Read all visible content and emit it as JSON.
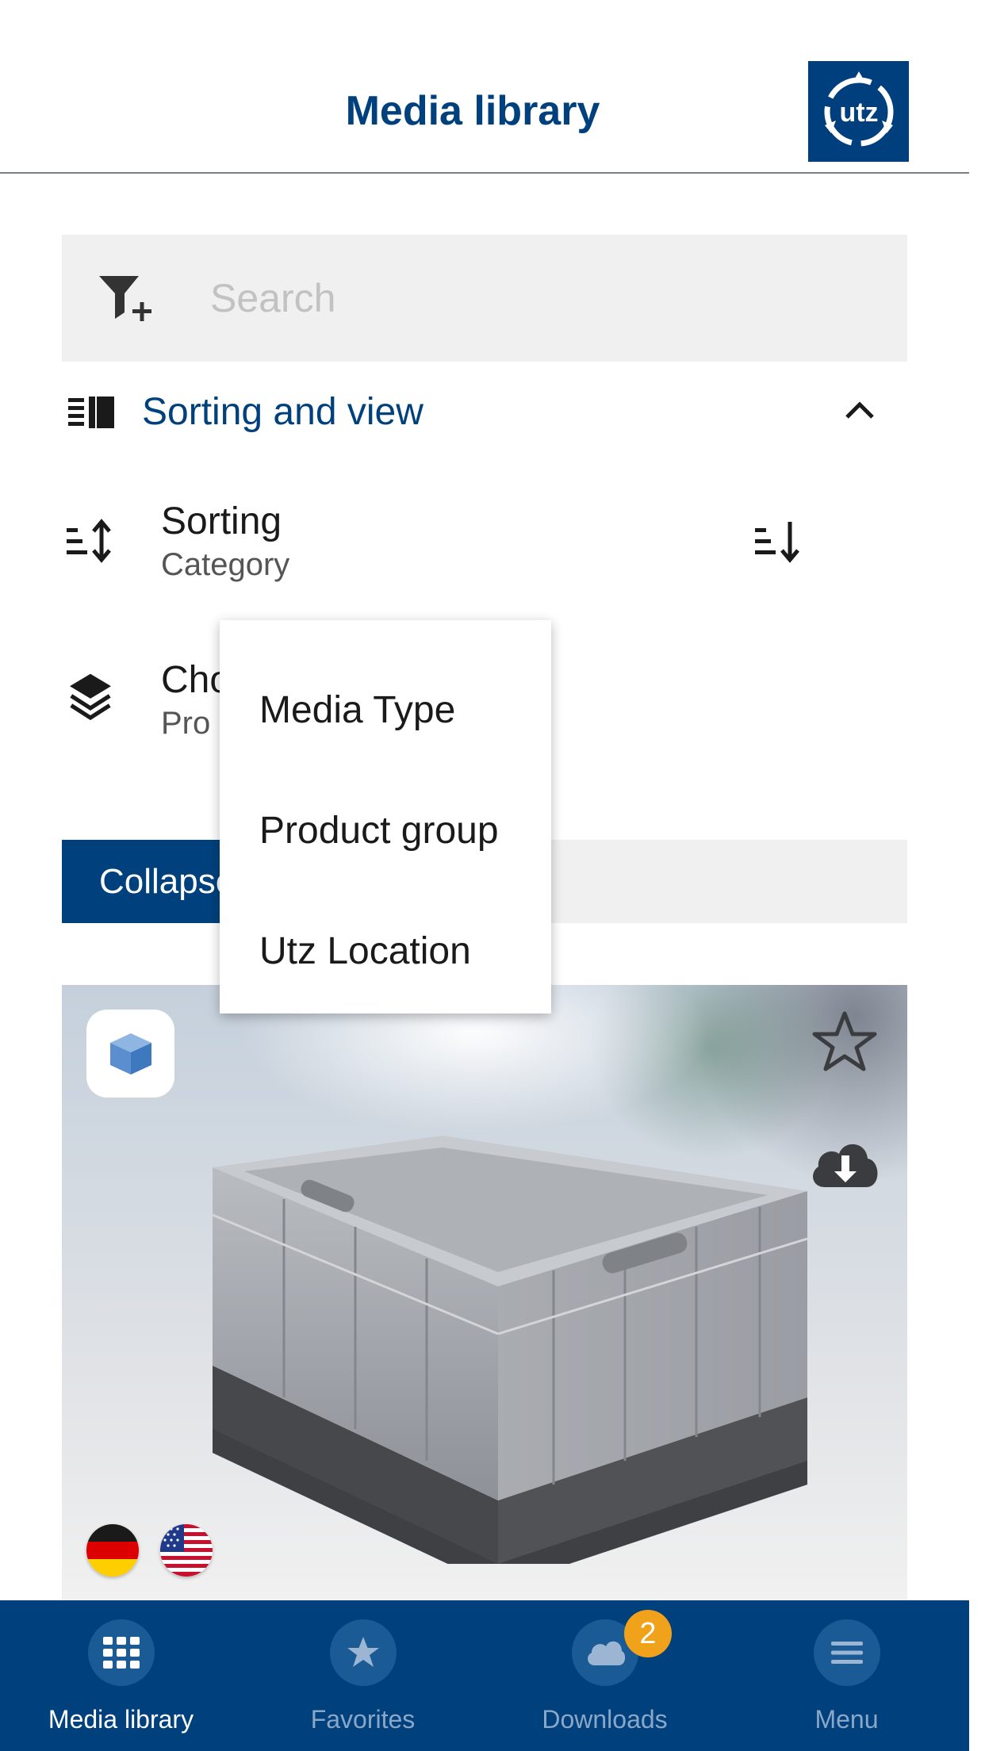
{
  "header": {
    "title": "Media library",
    "logo_text": "utz"
  },
  "search": {
    "placeholder": "Search",
    "filter_icon": "filter-add-icon"
  },
  "sorting_view": {
    "label": "Sorting and view",
    "expanded": true
  },
  "sorting": {
    "title": "Sorting",
    "value": "Category",
    "direction_icon": "sort-descending-icon"
  },
  "choose": {
    "title": "Cho",
    "value": "Pro"
  },
  "collapse": {
    "label": "Collapse"
  },
  "dropdown": {
    "options": [
      "Media Type",
      "Product group",
      "Utz Location"
    ]
  },
  "card": {
    "type_icon": "3d-cube-icon",
    "languages": [
      "German",
      "US English"
    ]
  },
  "tabs": [
    {
      "label": "Media library",
      "icon": "grid-icon",
      "active": true
    },
    {
      "label": "Favorites",
      "icon": "star-icon",
      "active": false
    },
    {
      "label": "Downloads",
      "icon": "cloud-icon",
      "active": false,
      "badge": "2"
    },
    {
      "label": "Menu",
      "icon": "menu-icon",
      "active": false
    }
  ],
  "colors": {
    "brand": "#00417d",
    "badge": "#f0a21b",
    "panel": "#f0f0f0"
  }
}
